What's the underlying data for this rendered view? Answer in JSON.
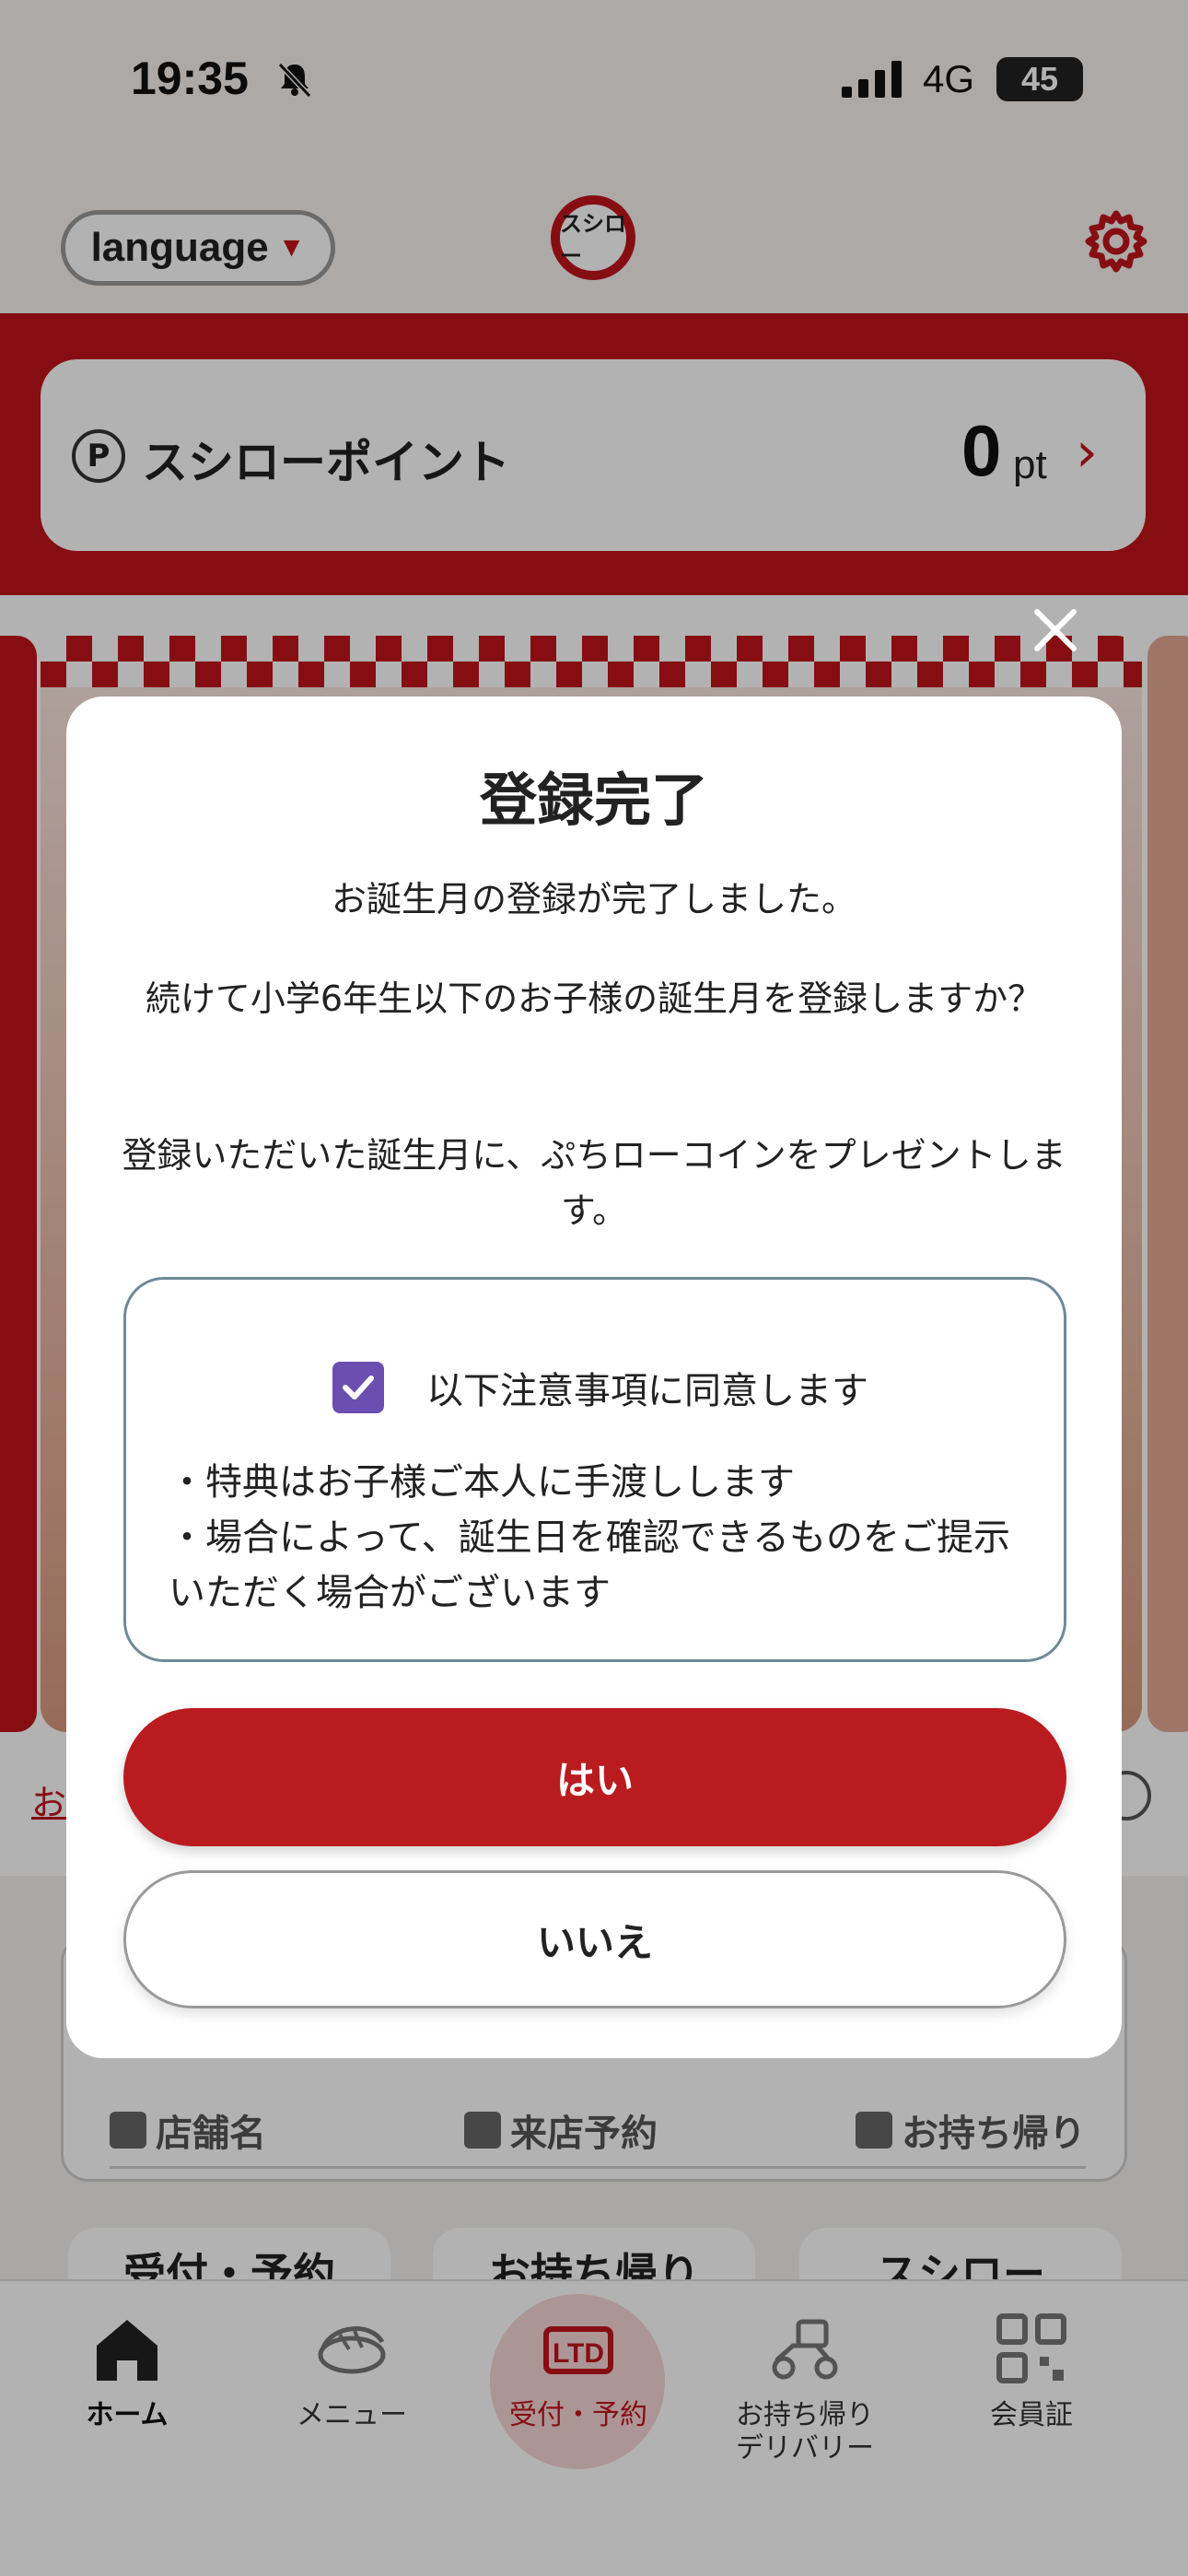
{
  "status_bar": {
    "time": "19:35",
    "network": "4G",
    "battery": "45"
  },
  "header": {
    "language_label": "language",
    "logo_text": "スシロー"
  },
  "points": {
    "icon_letter": "P",
    "label": "スシローポイント",
    "value": "0",
    "unit": "pt"
  },
  "banner": {
    "link_text": "お"
  },
  "search": {
    "tabs": [
      "店舗名",
      "来店予約",
      "お持ち帰り"
    ]
  },
  "shortcuts": [
    "受付・予約",
    "お持ち帰り",
    "スシロー"
  ],
  "bottom_nav": [
    {
      "label": "ホーム",
      "icon": "home-icon"
    },
    {
      "label": "メニュー",
      "icon": "sushi-icon"
    },
    {
      "label": "受付・予約",
      "icon": "reception-icon"
    },
    {
      "label": "お持ち帰り\nデリバリー",
      "icon": "delivery-scooter-icon"
    },
    {
      "label": "会員証",
      "icon": "qr-code-icon"
    }
  ],
  "modal": {
    "title": "登録完了",
    "message1": "お誕生月の登録が完了しました。",
    "message2": "続けて小学6年生以下のお子様の誕生月を登録しますか？",
    "message3": "登録いただいた誕生月に、ぷちローコインをプレゼントします。",
    "agree_label": "以下注意事項に同意します",
    "agree_checked": true,
    "notice_line1": "・特典はお子様ご本人に手渡しします",
    "notice_line2": "・場合によって、誕生日を確認できるものをご提示いただく場合がございます",
    "yes_label": "はい",
    "no_label": "いいえ"
  },
  "colors": {
    "brand_red": "#c1151c",
    "button_red": "#ba1b1f",
    "checkbox_purple": "#6a4fb0"
  }
}
